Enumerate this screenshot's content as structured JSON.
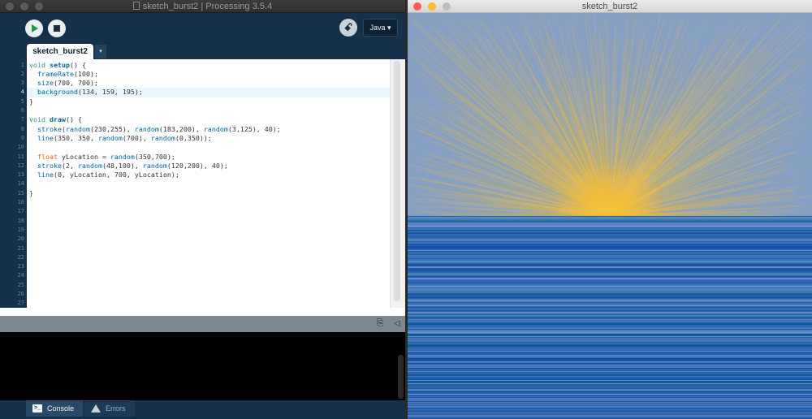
{
  "ide": {
    "title": "sketch_burst2 | Processing 3.5.4",
    "mode_label": "Java ▾",
    "tab_label": "sketch_burst2",
    "tab_menu_glyph": "▾",
    "debug_glyph": "ꗃ",
    "current_line": 4,
    "line_numbers": [
      "1",
      "2",
      "3",
      "4",
      "5",
      "6",
      "7",
      "8",
      "9",
      "10",
      "11",
      "12",
      "13",
      "14",
      "15",
      "16",
      "17",
      "18",
      "19",
      "20",
      "21",
      "22",
      "23",
      "24",
      "25",
      "26",
      "27"
    ],
    "code_lines": [
      [
        [
          "kw",
          "void "
        ],
        [
          "fnb",
          "setup"
        ],
        [
          "tx",
          "() {"
        ]
      ],
      [
        [
          "tx",
          "  "
        ],
        [
          "fn",
          "frameRate"
        ],
        [
          "tx",
          "(100);"
        ]
      ],
      [
        [
          "tx",
          "  "
        ],
        [
          "fn",
          "size"
        ],
        [
          "tx",
          "(700, 700);"
        ]
      ],
      [
        [
          "tx",
          "  "
        ],
        [
          "fn",
          "background"
        ],
        [
          "tx",
          "(134, 159, 195);"
        ]
      ],
      [
        [
          "tx",
          "}"
        ]
      ],
      [
        [
          "tx",
          ""
        ]
      ],
      [
        [
          "kw",
          "void "
        ],
        [
          "fnb",
          "draw"
        ],
        [
          "tx",
          "() {"
        ]
      ],
      [
        [
          "tx",
          "  "
        ],
        [
          "fn",
          "stroke"
        ],
        [
          "tx",
          "("
        ],
        [
          "fn",
          "random"
        ],
        [
          "tx",
          "(230,255), "
        ],
        [
          "fn",
          "random"
        ],
        [
          "tx",
          "(183,200), "
        ],
        [
          "fn",
          "random"
        ],
        [
          "tx",
          "(3,125), 40);"
        ]
      ],
      [
        [
          "tx",
          "  "
        ],
        [
          "fn",
          "line"
        ],
        [
          "tx",
          "(350, 350, "
        ],
        [
          "fn",
          "random"
        ],
        [
          "tx",
          "(700), "
        ],
        [
          "fn",
          "random"
        ],
        [
          "tx",
          "(0,350));"
        ]
      ],
      [
        [
          "tx",
          ""
        ]
      ],
      [
        [
          "tx",
          "  "
        ],
        [
          "ty",
          "float"
        ],
        [
          "tx",
          " yLocation = "
        ],
        [
          "fn",
          "random"
        ],
        [
          "tx",
          "(350,700);"
        ]
      ],
      [
        [
          "tx",
          "  "
        ],
        [
          "fn",
          "stroke"
        ],
        [
          "tx",
          "(2, "
        ],
        [
          "fn",
          "random"
        ],
        [
          "tx",
          "(48,100), "
        ],
        [
          "fn",
          "random"
        ],
        [
          "tx",
          "(120,200), 40);"
        ]
      ],
      [
        [
          "tx",
          "  "
        ],
        [
          "fn",
          "line"
        ],
        [
          "tx",
          "(0, yLocation, 700, yLocation);"
        ]
      ],
      [
        [
          "tx",
          ""
        ]
      ],
      [
        [
          "tx",
          "}"
        ]
      ]
    ],
    "console_tab_label": "Console",
    "errors_tab_label": "Errors"
  },
  "sketch": {
    "title": "sketch_burst2",
    "sky_color": "#86a0c3",
    "sea_color": "#2a63a8",
    "sun_color": "#f4bd3a"
  }
}
